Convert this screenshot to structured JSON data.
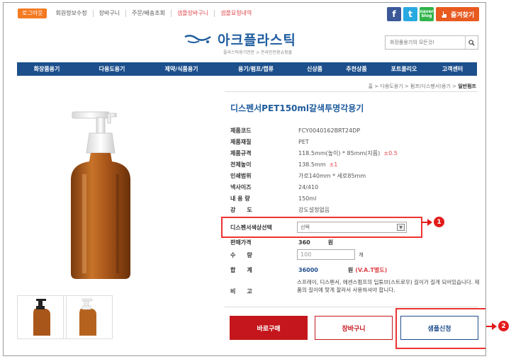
{
  "topbar": {
    "logout": "로그아웃",
    "links": [
      "회원정보수정",
      "장바구니",
      "주문/배송조회",
      "샘플장바구니",
      "샘플요청내역"
    ]
  },
  "social": {
    "fb": "f",
    "tw": "t",
    "blog_top": "naver",
    "blog_bottom": "blog",
    "favorites": "즐겨찾기"
  },
  "logo": {
    "title": "아크플라스틱",
    "subtitle": "플라스틱용기전문 > 온라인전용쇼핑몰"
  },
  "search": {
    "placeholder": "화장품용기의 모든것!"
  },
  "nav": [
    "화장품용기",
    "다용도용기",
    "제약/식품용기",
    "용기/펌프/캡류",
    "신상품",
    "추천상품",
    "포트폴리오",
    "고객센터"
  ],
  "breadcrumb": {
    "home": "홈",
    "path": [
      "다용도용기",
      "펌프(디스펜서)용기"
    ],
    "current": "일반펌프"
  },
  "product": {
    "title": "디스펜서PET150ml갈색투명각용기",
    "specs": [
      {
        "label": "제품코드",
        "value": "FCY0040162BRT24DP",
        "extra": ""
      },
      {
        "label": "제품재질",
        "value": "PET",
        "extra": ""
      },
      {
        "label": "제품규격",
        "value": "118.5mm(높이) * 85mm(지름)",
        "extra": "±0.5"
      },
      {
        "label": "전체높이",
        "value": "138.5mm",
        "extra": "±1"
      },
      {
        "label": "인쇄범위",
        "value": "가로140mm * 세로85mm",
        "extra": ""
      },
      {
        "label": "넥사이즈",
        "value": "24/410",
        "extra": ""
      },
      {
        "label": "내 용 량",
        "value": "150ml",
        "extra": ""
      },
      {
        "label": "강　　도",
        "value": "강도설정없음",
        "extra": ""
      }
    ],
    "color_select": {
      "label": "디스펜서색상선택",
      "value": "선택"
    },
    "price": {
      "label": "판매가격",
      "value": "360",
      "unit": "원"
    },
    "quantity": {
      "label": "수　　량",
      "placeholder": "100",
      "unit": "개"
    },
    "total": {
      "label": "합　　계",
      "value": "36000",
      "unit": "원",
      "vat": "(V.A.T별도)"
    },
    "note": {
      "label": "비　　고",
      "text": "스프레이, 디스펜서, 에센스펌프의 딥튜브(스트로우) 길이가 길게 되어있습니다. 제품의 길이에 맞게 잘라서 사용하셔야 합니다."
    },
    "buttons": {
      "buy": "바로구매",
      "cart": "장바구니",
      "sample": "샘플신청"
    }
  },
  "annotations": {
    "one": "1",
    "two": "2"
  },
  "colors": {
    "nav": "#1c4f8c",
    "buy": "#c4161c",
    "accent": "#e31b1b",
    "amber": "#b5621e"
  }
}
